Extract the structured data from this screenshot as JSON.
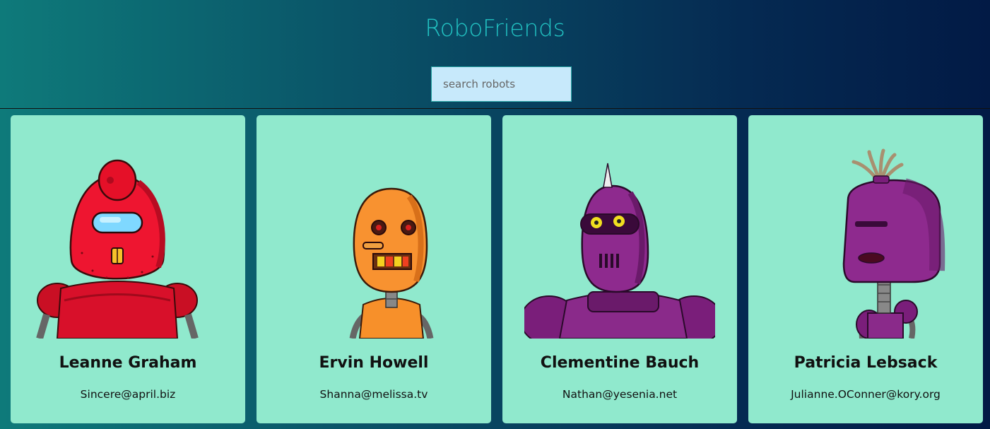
{
  "header": {
    "title": "RoboFriends",
    "title_color": "#22c2c2"
  },
  "search": {
    "placeholder": "search robots",
    "value": ""
  },
  "robots": [
    {
      "name": "Leanne Graham",
      "email": "Sincere@april.biz",
      "color": "#e8102a",
      "icon": "red-robot-icon"
    },
    {
      "name": "Ervin Howell",
      "email": "Shanna@melissa.tv",
      "color": "#f7902a",
      "icon": "orange-robot-icon"
    },
    {
      "name": "Clementine Bauch",
      "email": "Nathan@yesenia.net",
      "color": "#8e2a8e",
      "icon": "purple-spike-robot-icon"
    },
    {
      "name": "Patricia Lebsack",
      "email": "Julianne.OConner@kory.org",
      "color": "#8c2a8a",
      "icon": "purple-antenna-robot-icon"
    }
  ],
  "colors": {
    "card_background": "#90e9cd",
    "search_background": "#c7e9fb"
  }
}
